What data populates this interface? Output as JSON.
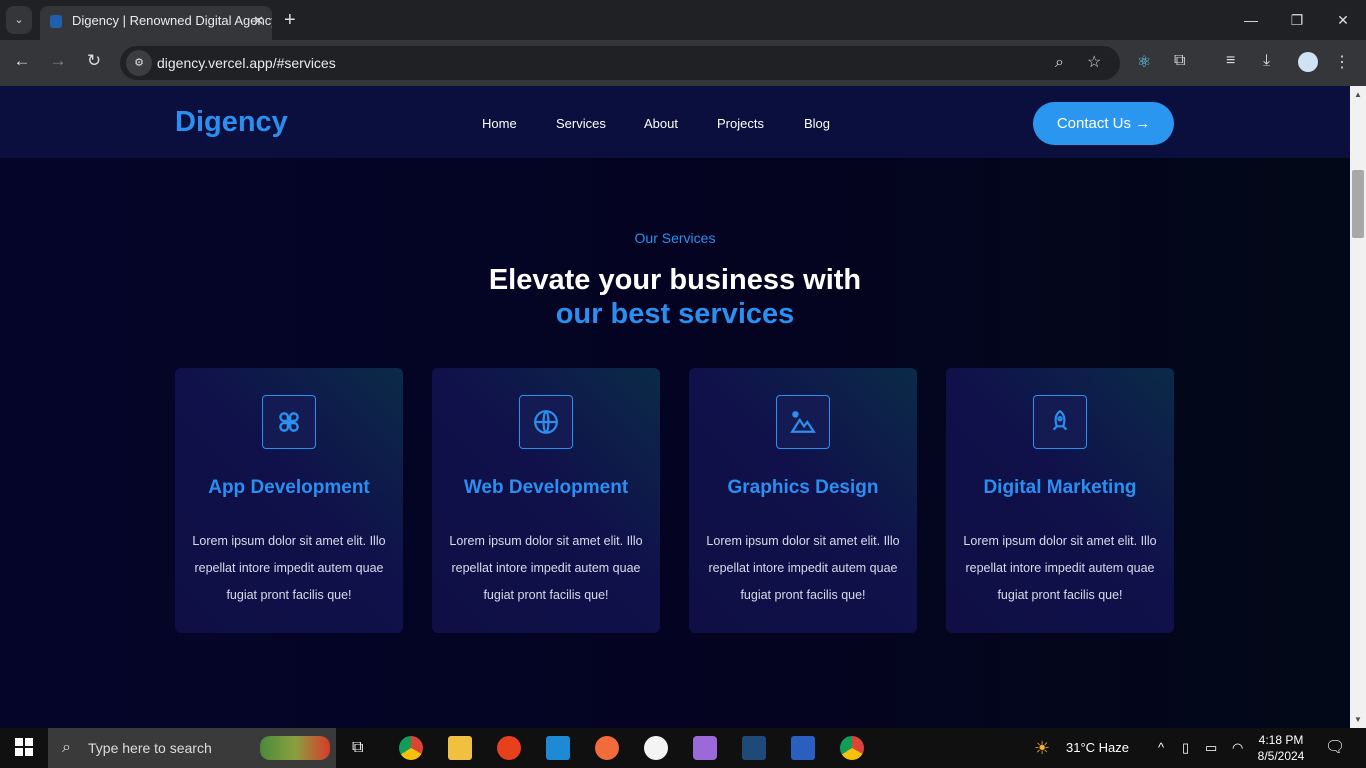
{
  "browser": {
    "tab_title": "Digency | Renowned Digital Agency",
    "url": "digency.vercel.app/#services",
    "colors": {
      "accent": "#2b8ff0",
      "background": "#04041f",
      "navbar": "#0b0f3d"
    }
  },
  "site": {
    "logo": "Digency",
    "nav": [
      "Home",
      "Services",
      "About",
      "Projects",
      "Blog"
    ],
    "cta": "Contact Us"
  },
  "services": {
    "eyebrow": "Our Services",
    "heading_line1": "Elevate your business with",
    "heading_line2": "our best services",
    "cards": [
      {
        "icon": "command-icon",
        "title": "App Development",
        "desc": "Lorem ipsum dolor sit amet elit. Illo repellat intore impedit autem quae fugiat pront facilis que!"
      },
      {
        "icon": "globe-icon",
        "title": "Web Development",
        "desc": "Lorem ipsum dolor sit amet elit. Illo repellat intore impedit autem quae fugiat pront facilis que!"
      },
      {
        "icon": "image-icon",
        "title": "Graphics Design",
        "desc": "Lorem ipsum dolor sit amet elit. Illo repellat intore impedit autem quae fugiat pront facilis que!"
      },
      {
        "icon": "rocket-icon",
        "title": "Digital Marketing",
        "desc": "Lorem ipsum dolor sit amet elit. Illo repellat intore impedit autem quae fugiat pront facilis que!"
      }
    ]
  },
  "taskbar": {
    "search_placeholder": "Type here to search",
    "weather": "31°C  Haze",
    "time": "4:18 PM",
    "date": "8/5/2024"
  }
}
